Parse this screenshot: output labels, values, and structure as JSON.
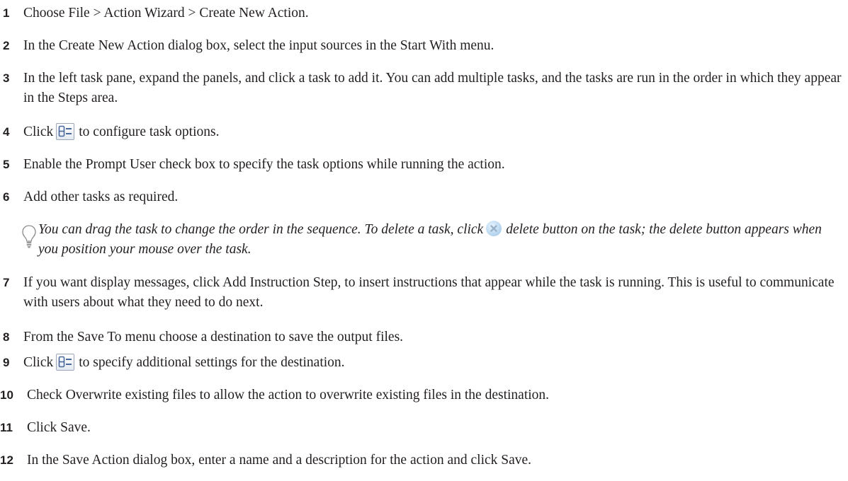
{
  "steps": [
    {
      "num": "1",
      "text": "Choose File > Action Wizard > Create New Action."
    },
    {
      "num": "2",
      "text": "In the Create New Action dialog box, select the input sources in the Start With menu."
    },
    {
      "num": "3",
      "text": "In the left task pane, expand the panels, and click a task to add it. You can add multiple tasks, and the tasks are run in the order in which they appear in the Steps area."
    },
    {
      "num": "4",
      "before": "Click",
      "after": "to configure task options."
    },
    {
      "num": "5",
      "text": "Enable the Prompt User check box to specify the task options while running the action."
    },
    {
      "num": "6",
      "text": "Add other tasks as required."
    },
    {
      "num": "7",
      "text": "If you want display messages, click Add Instruction Step, to insert instructions that appear while the task is running. This is useful to communicate with users about what they need to do next."
    },
    {
      "num": "8",
      "text": "From the Save To menu choose a destination to save the output files."
    },
    {
      "num": "9",
      "before": "Click",
      "after": "to specify additional settings for the destination."
    },
    {
      "num": "10",
      "text": "Check Overwrite existing files to allow the action to overwrite existing files in the destination."
    },
    {
      "num": "11",
      "text": "Click Save."
    },
    {
      "num": "12",
      "text": "In the Save Action dialog box, enter a name and a description for the action and click Save."
    }
  ],
  "tip": {
    "before": "You can drag the task to change the order in the sequence. To delete a task, click",
    "after": "delete button on the task; the delete button appears when you position your mouse over the task."
  },
  "icons": {
    "configure": "task-options-icon",
    "delete": "delete-task-icon",
    "tip": "lightbulb-tip-icon"
  }
}
